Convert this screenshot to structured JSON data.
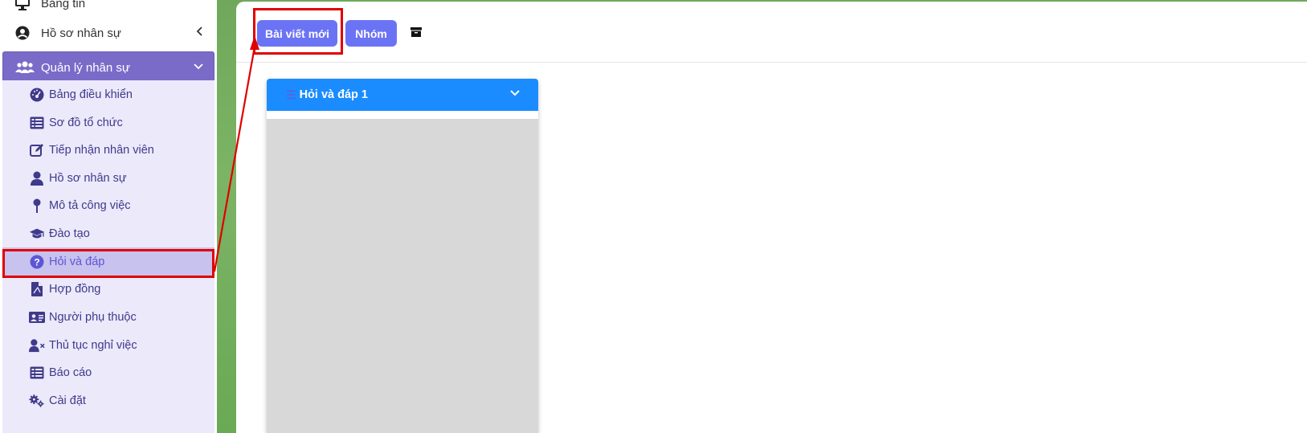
{
  "sidebar": {
    "top_items": [
      {
        "label": "Bảng tin",
        "icon": "monitor-icon"
      },
      {
        "label": "Hồ sơ nhân sự",
        "icon": "user-circle-icon"
      }
    ],
    "group": {
      "label": "Quản lý nhân sự",
      "icon": "users-icon"
    },
    "sub_items": [
      {
        "label": "Bảng điều khiển",
        "icon": "dashboard-gauge-icon"
      },
      {
        "label": "Sơ đồ tổ chức",
        "icon": "list-table-icon"
      },
      {
        "label": "Tiếp nhận nhân viên",
        "icon": "edit-icon"
      },
      {
        "label": "Hồ sơ nhân sự",
        "icon": "user-icon"
      },
      {
        "label": "Mô tả công việc",
        "icon": "map-pin-icon"
      },
      {
        "label": "Đào tạo",
        "icon": "graduation-cap-icon"
      },
      {
        "label": "Hỏi và đáp",
        "icon": "question-circle-icon"
      },
      {
        "label": "Hợp đồng",
        "icon": "file-pdf-icon"
      },
      {
        "label": "Người phụ thuộc",
        "icon": "id-card-icon"
      },
      {
        "label": "Thủ tục nghỉ việc",
        "icon": "user-remove-icon"
      },
      {
        "label": "Báo cáo",
        "icon": "report-list-icon"
      },
      {
        "label": "Cài đặt",
        "icon": "cogs-icon"
      }
    ],
    "active_item": "Hỏi và đáp"
  },
  "toolbar": {
    "new_post_label": "Bài viết mới",
    "group_label": "Nhóm",
    "archive_icon": "archive-icon"
  },
  "card": {
    "title": "Hỏi và đáp 1"
  },
  "colors": {
    "accent": "#6b73f5",
    "sidebar_group": "#7a6bc9",
    "submenu_bg": "#ece9fb",
    "active_bg": "#c8c2ee",
    "card_header": "#1a8cff",
    "highlight": "#e00000",
    "backdrop": "#75af60"
  }
}
